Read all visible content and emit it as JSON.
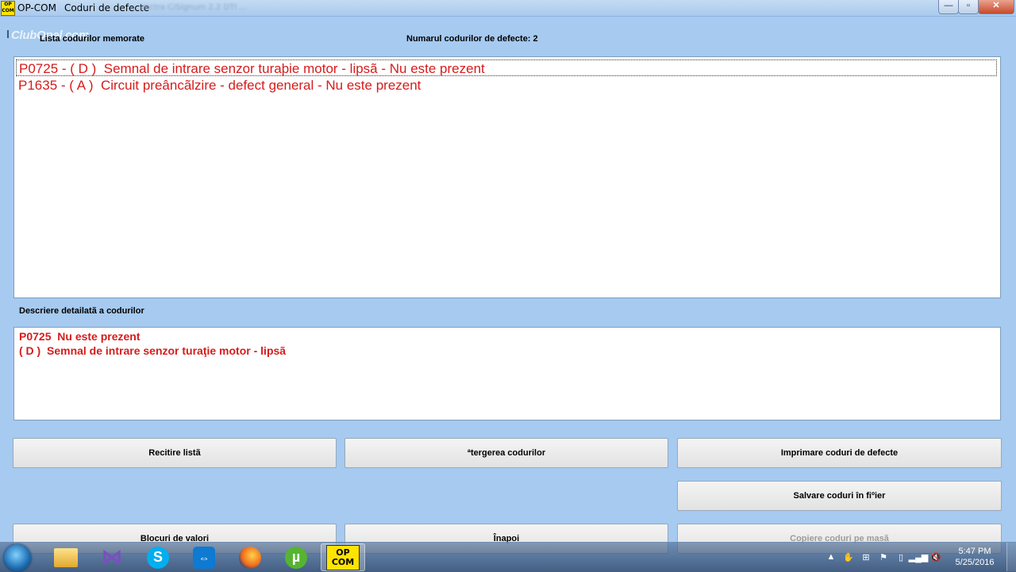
{
  "window": {
    "app_name": "OP-COM",
    "title": "Coduri de defecte",
    "title_extra": "Vectra C/Signum 2.2 DTI ...",
    "app_icon_text_top": "OP",
    "app_icon_text_bottom": "COM",
    "minimize": "—",
    "maximize": "▫",
    "close": "✕"
  },
  "watermark": "ClubOpel.com",
  "list_label": "Lista codurilor memorate",
  "count_label": "Numarul codurilor de defecte: 2",
  "codes": [
    "P0725 - ( D )  Semnal de intrare senzor turaþie motor - lipsã - Nu este prezent",
    "P1635 - ( A )  Circuit preâncãlzire - defect general - Nu este prezent"
  ],
  "desc_label": "Descriere detailatã a codurilor",
  "description": [
    "P0725  Nu este prezent",
    "( D )  Semnal de intrare senzor turaţie motor - lipsã"
  ],
  "buttons": {
    "reread": "Recitire listã",
    "erase": "ªtergerea codurilor",
    "print": "Imprimare coduri de defecte",
    "save": "Salvare coduri în fiºier",
    "blocks": "Blocuri de valori",
    "back": "Înapoi",
    "copy": "Copiere coduri pe masã"
  },
  "taskbar": {
    "apps": [
      "folder-icon",
      "visual-studio-icon",
      "skype-icon",
      "teamviewer-icon",
      "firefox-icon",
      "utorrent-icon",
      "opcom-icon"
    ],
    "opcom_top": "OP",
    "opcom_bottom": "COM",
    "time": "5:47 PM",
    "date": "5/25/2016"
  },
  "colors": {
    "window_bg": "#a6caf0",
    "code_text": "#d61c1c"
  }
}
